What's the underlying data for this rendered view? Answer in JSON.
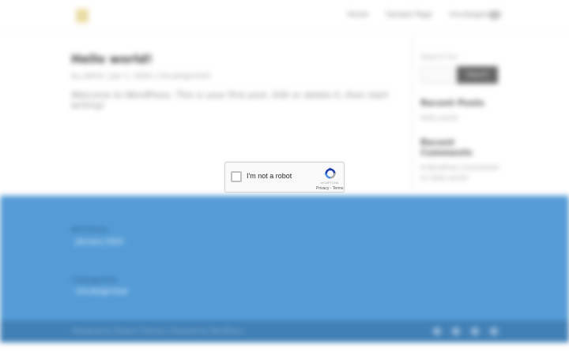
{
  "header": {
    "nav": [
      "Home",
      "Sample Page",
      "Uncategorized"
    ]
  },
  "main": {
    "title": "Hello world!",
    "meta": "by admin | Jan 1, 2024 | Uncategorized",
    "body": "Welcome to WordPress. This is your first post. Edit or delete it, then start writing!"
  },
  "sidebar": {
    "search_label": "Search for:",
    "search_button": "Search",
    "recent_posts_heading": "Recent Posts",
    "recent_post": "Hello world!",
    "recent_comments_heading": "Recent Comments",
    "recent_comment": "A WordPress Commenter on Hello world!"
  },
  "footer": {
    "archives_heading": "Archives",
    "archives_link": "January 2024",
    "categories_heading": "Categories",
    "categories_link": "Uncategorized",
    "copyright": "Designed by Elegant Themes | Powered by WordPress"
  },
  "recaptcha": {
    "label": "I'm not a robot",
    "brand": "reCAPTCHA",
    "privacy_link": "Privacy",
    "separator": " - ",
    "terms_link": "Terms",
    "colors": {
      "logo_blue": "#1c3aa9",
      "logo_light": "#4a90e2",
      "logo_grey": "#ababab"
    }
  }
}
